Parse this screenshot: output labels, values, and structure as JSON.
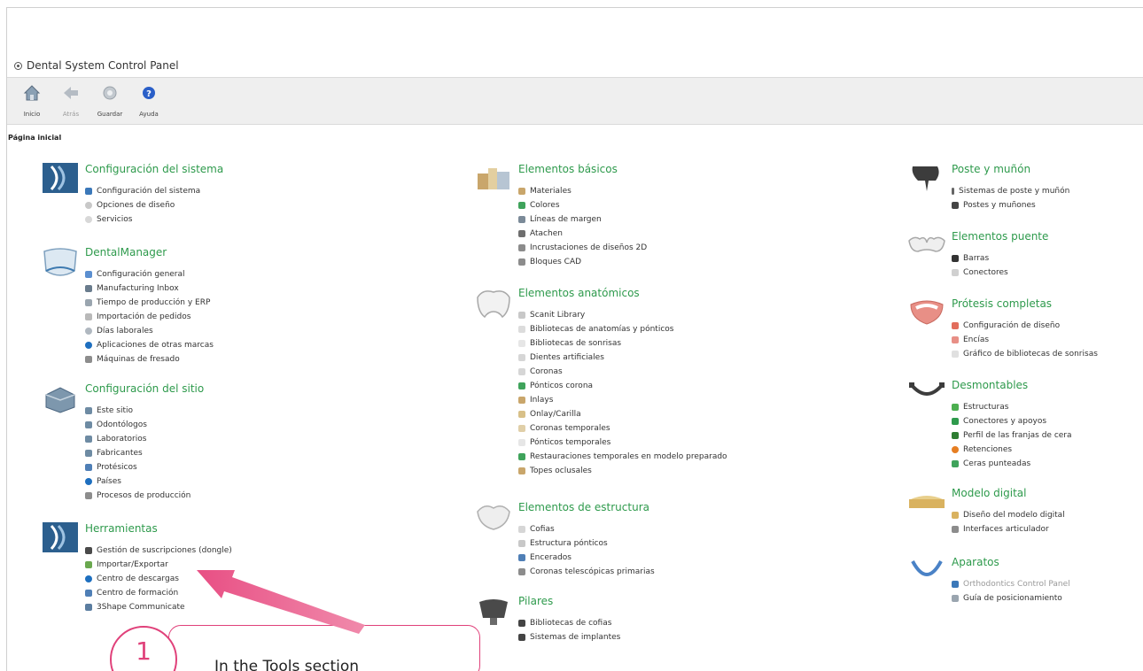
{
  "window": {
    "title": "Dental System Control Panel"
  },
  "toolbar": {
    "buttons": [
      {
        "label": "Inicio",
        "icon": "home-icon",
        "disabled": false
      },
      {
        "label": "Atrás",
        "icon": "back-arrow-icon",
        "disabled": true
      },
      {
        "label": "Guardar",
        "icon": "save-gear-icon",
        "disabled": true
      },
      {
        "label": "Ayuda",
        "icon": "help-icon",
        "disabled": false
      }
    ]
  },
  "page": {
    "heading": "Página inicial"
  },
  "sections": {
    "sistema": {
      "title": "Configuración del sistema",
      "items": [
        "Configuración del sistema",
        "Opciones de diseño",
        "Servicios"
      ]
    },
    "dentalmanager": {
      "title": "DentalManager",
      "items": [
        "Configuración general",
        "Manufacturing Inbox",
        "Tiempo de producción y ERP",
        "Importación de pedidos",
        "Días laborales",
        "Aplicaciones de otras marcas",
        "Máquinas de fresado"
      ]
    },
    "sitio": {
      "title": "Configuración del sitio",
      "items": [
        "Este sitio",
        "Odontólogos",
        "Laboratorios",
        "Fabricantes",
        "Protésicos",
        "Países",
        "Procesos de producción"
      ]
    },
    "herramientas": {
      "title": "Herramientas",
      "items": [
        "Gestión de suscripciones (dongle)",
        "Importar/Exportar",
        "Centro de descargas",
        "Centro de formación",
        "3Shape Communicate"
      ]
    },
    "basicos": {
      "title": "Elementos básicos",
      "items": [
        "Materiales",
        "Colores",
        "Líneas de margen",
        "Atachen",
        "Incrustaciones de diseños 2D",
        "Bloques CAD"
      ]
    },
    "anatomicos": {
      "title": "Elementos anatómicos",
      "items": [
        "Scanit Library",
        "Bibliotecas de anatomías y pónticos",
        "Bibliotecas de sonrisas",
        "Dientes artificiales",
        "Coronas",
        "Pónticos corona",
        "Inlays",
        "Onlay/Carilla",
        "Coronas temporales",
        "Pónticos temporales",
        "Restauraciones temporales en modelo preparado",
        "Topes oclusales"
      ]
    },
    "estructura": {
      "title": "Elementos de estructura",
      "items": [
        "Cofias",
        "Estructura pónticos",
        "Encerados",
        "Coronas telescópicas primarias"
      ]
    },
    "pilares": {
      "title": "Pilares",
      "items": [
        "Bibliotecas de cofias",
        "Sistemas de implantes"
      ]
    },
    "poste": {
      "title": "Poste y muñón",
      "items": [
        "Sistemas de poste y muñón",
        "Postes y muñones"
      ]
    },
    "puente": {
      "title": "Elementos puente",
      "items": [
        "Barras",
        "Conectores"
      ]
    },
    "protesis": {
      "title": "Prótesis completas",
      "items": [
        "Configuración de diseño",
        "Encías",
        "Gráfico de bibliotecas de sonrisas"
      ]
    },
    "desmontables": {
      "title": "Desmontables",
      "items": [
        "Estructuras",
        "Conectores y apoyos",
        "Perfil de las franjas de cera",
        "Retenciones",
        "Ceras punteadas"
      ]
    },
    "modelo": {
      "title": "Modelo digital",
      "items": [
        "Diseño del modelo digital",
        "Interfaces articulador"
      ]
    },
    "aparatos": {
      "title": "Aparatos",
      "items": [
        "Orthodontics Control Panel",
        "Guía de posicionamiento"
      ]
    }
  },
  "callout": {
    "number": "1",
    "text": "In the Tools section",
    "color": "#e0417a"
  },
  "colors": {
    "section_title": "#2e9a4c",
    "accent": "#e0417a"
  }
}
